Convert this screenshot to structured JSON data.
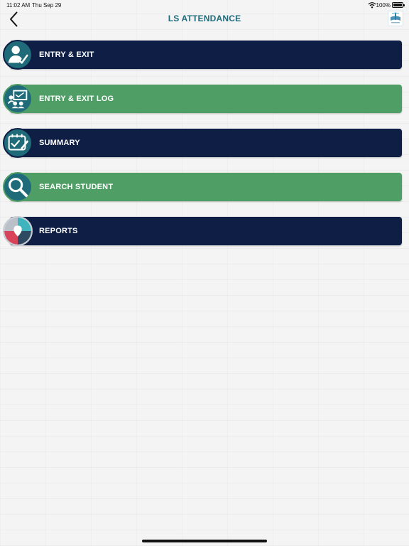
{
  "status_bar": {
    "time": "11:02 AM",
    "date": "Thu Sep 29",
    "battery": "100%",
    "wifi_icon": "wifi-icon",
    "battery_icon": "battery-icon"
  },
  "header": {
    "title": "LS ATTENDANCE",
    "back_icon": "chevron-left-icon",
    "logo_icon": "school-logo-icon"
  },
  "colors": {
    "navy": "#0e1e45",
    "green": "#4f9e66",
    "title": "#1f6b7a",
    "icon_teal": "#1f6b7a"
  },
  "menu": {
    "items": [
      {
        "label": "ENTRY & EXIT",
        "icon": "person-check-icon",
        "color": "#0e1e45"
      },
      {
        "label": "ENTRY & EXIT LOG",
        "icon": "classroom-log-icon",
        "color": "#4f9e66"
      },
      {
        "label": "SUMMARY",
        "icon": "calendar-check-icon",
        "color": "#0e1e45"
      },
      {
        "label": "SEARCH STUDENT",
        "icon": "magnifier-icon",
        "color": "#4f9e66"
      },
      {
        "label": "REPORTS",
        "icon": "pie-chart-icon",
        "color": "#0e1e45"
      }
    ]
  }
}
